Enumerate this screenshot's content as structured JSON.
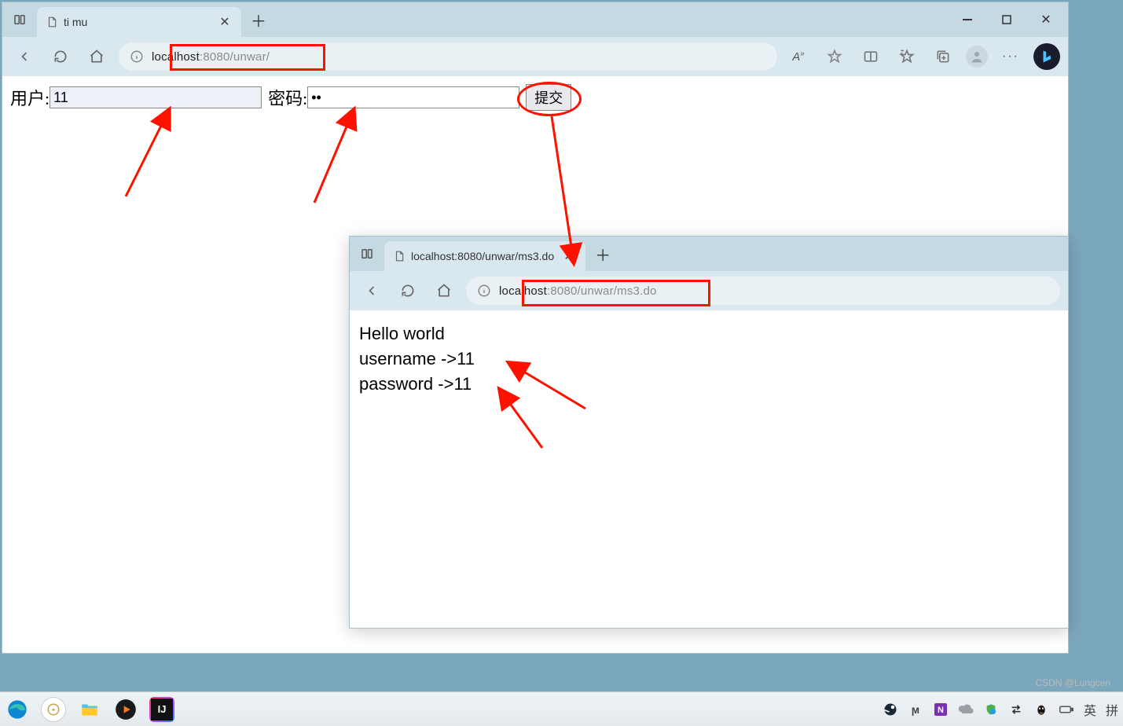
{
  "window1": {
    "tab_title": "ti mu",
    "url_host": "localhost",
    "url_port_path": ":8080/unwar/",
    "form": {
      "user_label": "用户:",
      "user_value": "11",
      "pass_label": "密码:",
      "pass_value": "••",
      "submit_label": "提交"
    }
  },
  "window2": {
    "tab_title": "localhost:8080/unwar/ms3.do",
    "url_host": "localhost",
    "url_port_path": ":8080/unwar/ms3.do",
    "body": {
      "line1": "Hello world",
      "line2": "username ->11",
      "line3": "password ->11"
    }
  },
  "taskbar": {
    "ime_lang": "英",
    "ime_mode": "拼"
  },
  "watermark": "CSDN @Lungcen"
}
